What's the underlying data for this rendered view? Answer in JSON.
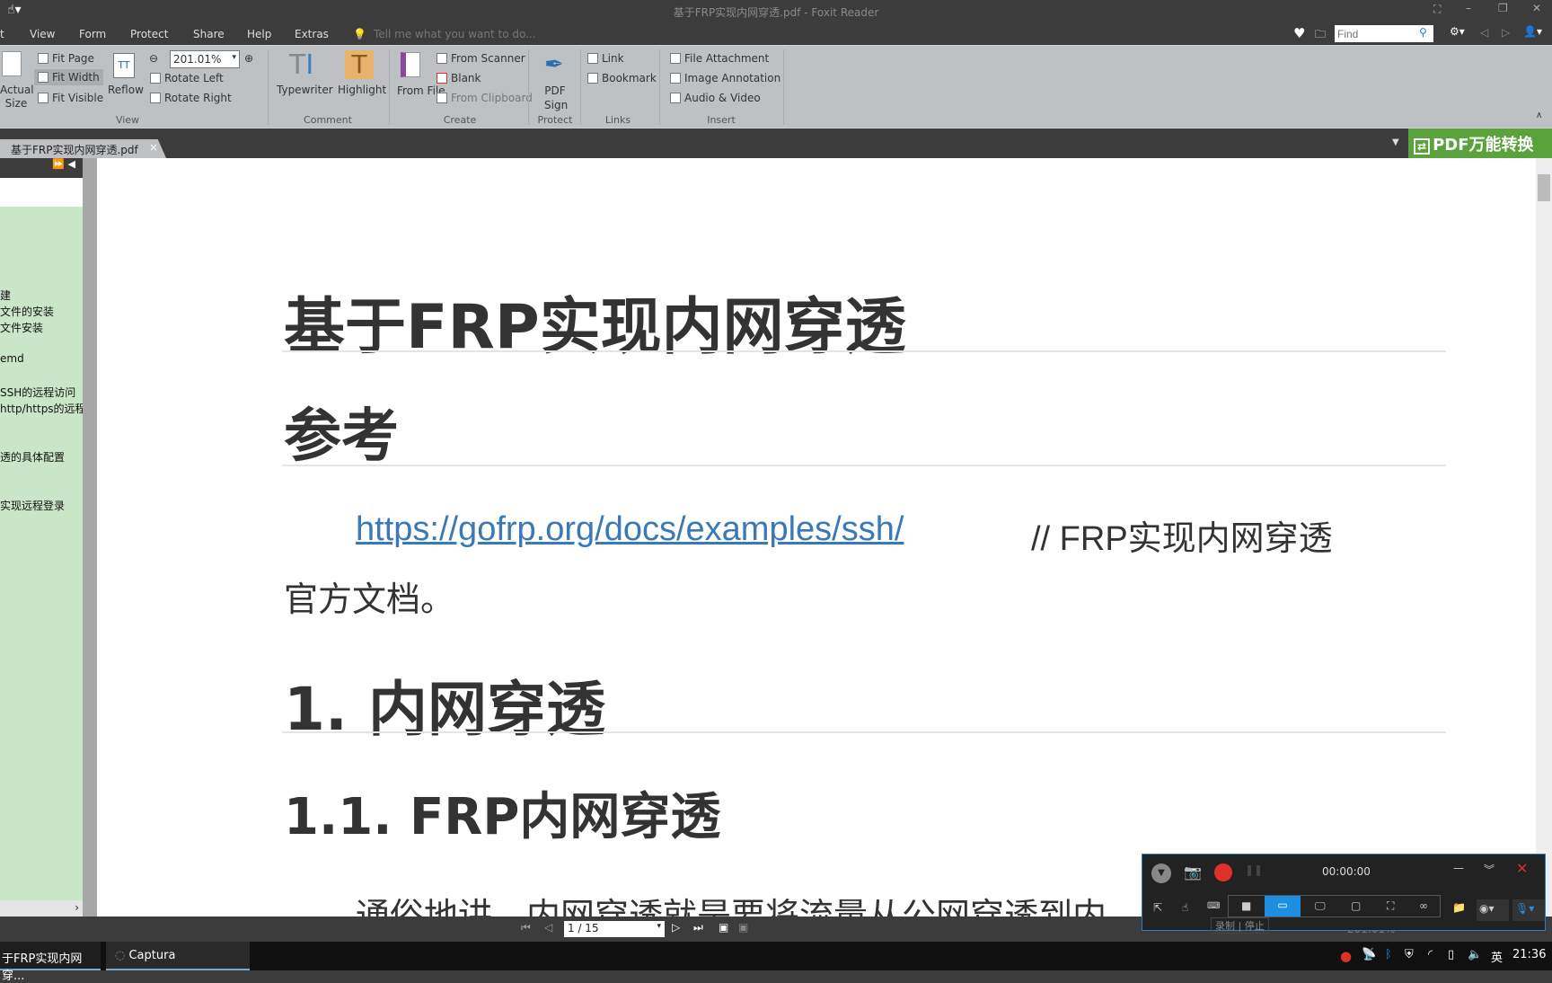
{
  "window": {
    "title": "基于FRP实现内网穿透.pdf - Foxit Reader"
  },
  "menu": [
    "t",
    "View",
    "Form",
    "Protect",
    "Share",
    "Help",
    "Extras"
  ],
  "tell_me": "Tell me what you want to do...",
  "find": {
    "placeholder": "Find"
  },
  "ribbon": {
    "actual_size": "Actual Size",
    "fit_page": "Fit Page",
    "fit_width": "Fit Width",
    "fit_visible": "Fit Visible",
    "reflow": "Reflow",
    "zoom": "201.01%",
    "rotate_left": "Rotate Left",
    "rotate_right": "Rotate Right",
    "group_view": "View",
    "typewriter": "Typewriter",
    "highlight": "Highlight",
    "group_comment": "Comment",
    "from_file": "From File",
    "from_scanner": "From Scanner",
    "blank": "Blank",
    "from_clipboard": "From Clipboard",
    "group_create": "Create",
    "pdf_sign": "PDF Sign",
    "group_protect": "Protect",
    "link": "Link",
    "bookmark": "Bookmark",
    "group_links": "Links",
    "file_attachment": "File Attachment",
    "image_annotation": "Image Annotation",
    "audio_video": "Audio & Video",
    "group_insert": "Insert"
  },
  "tab": {
    "label": "基于FRP实现内网穿透.pdf",
    "close": "×"
  },
  "pdf_convert": "PDF万能转换",
  "bookmarks": [
    "建",
    "文件的安装",
    "文件安装",
    "emd",
    "SSH的远程访问",
    "http/https的远程",
    "透的具体配置",
    "实现远程登录"
  ],
  "document": {
    "title": "基于FRP实现内网穿透",
    "h_ref": "参考",
    "link": "https://gofrp.org/docs/examples/ssh/",
    "link_note": "// FRP实现内网穿透",
    "link_note2": "官方文档。",
    "h1": "1. 内网穿透",
    "h11": "1.1. FRP内网穿透",
    "para": "通俗地讲，内网穿透就是要将流量从公网穿透到内"
  },
  "status": {
    "page": "1 / 15",
    "zoom": "201.01%"
  },
  "captura": {
    "timer": "00:00:00",
    "tooltip": "录制 | 停止"
  },
  "taskbar": {
    "foxit": "于FRP实现内网穿...",
    "captura": "Captura",
    "ime": "英",
    "time": "21:36"
  },
  "colors": {
    "link": "#3a78b8",
    "ribbon": "#bdc1c4",
    "panel": "#c9e6c8",
    "accent_green": "#5aa33c",
    "record": "#e0302a"
  }
}
